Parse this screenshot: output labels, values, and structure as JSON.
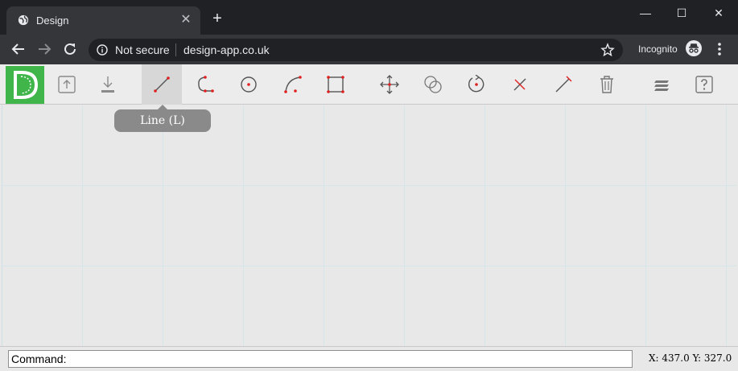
{
  "browser": {
    "tab": {
      "title": "Design",
      "close_glyph": "✕",
      "icon": "globe-icon"
    },
    "new_tab_glyph": "+",
    "window_controls": {
      "minimize": "—",
      "maximize": "☐",
      "close": "✕"
    },
    "omnibox": {
      "security_label": "Not secure",
      "url": "design-app.co.uk"
    },
    "incognito_label": "Incognito"
  },
  "toolbar": {
    "tools": [
      {
        "name": "open",
        "icon": "upload-file-icon"
      },
      {
        "name": "save",
        "icon": "download-icon"
      },
      {
        "name": "line",
        "icon": "line-icon",
        "active": true
      },
      {
        "name": "polyline",
        "icon": "polyline-icon"
      },
      {
        "name": "circle",
        "icon": "circle-icon"
      },
      {
        "name": "arc",
        "icon": "arc-icon"
      },
      {
        "name": "rectangle",
        "icon": "rectangle-icon"
      },
      {
        "name": "move",
        "icon": "move-icon"
      },
      {
        "name": "copy",
        "icon": "copy-icon"
      },
      {
        "name": "rotate",
        "icon": "rotate-icon"
      },
      {
        "name": "trim",
        "icon": "trim-icon"
      },
      {
        "name": "extend",
        "icon": "extend-icon"
      },
      {
        "name": "erase",
        "icon": "trash-icon"
      },
      {
        "name": "layers",
        "icon": "layers-icon"
      },
      {
        "name": "help",
        "icon": "help-icon"
      }
    ],
    "tooltip": "Line (L)"
  },
  "status": {
    "command_value": "Command:",
    "coordinates": "X: 437.0 Y: 327.0"
  },
  "colors": {
    "accent": "#3fb54a",
    "point": "#e02020",
    "grid": "#d4e6ea"
  }
}
